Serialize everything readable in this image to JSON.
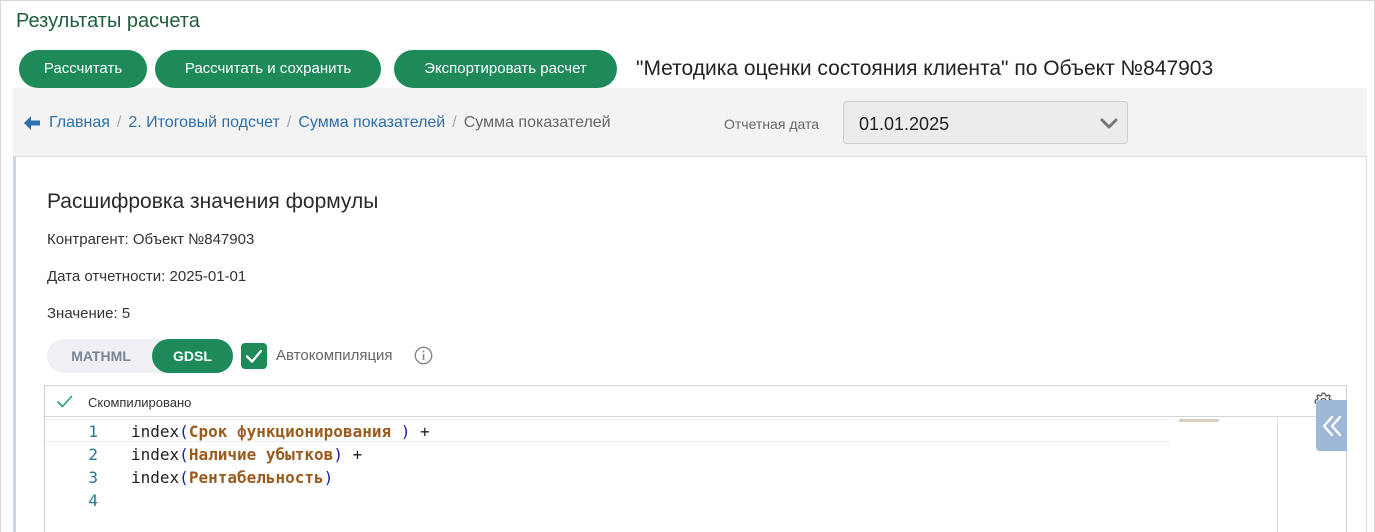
{
  "page": {
    "title": "Результаты расчета"
  },
  "actions": {
    "calculate": "Рассчитать",
    "calculate_save": "Рассчитать и сохранить",
    "export": "Экспортировать расчет"
  },
  "method_title": "\"Методика оценки состояния клиента\" по Объект №847903",
  "breadcrumb": {
    "items": [
      "Главная",
      "2. Итоговый подсчет",
      "Сумма показателей"
    ],
    "current": "Сумма показателей"
  },
  "report_date": {
    "label": "Отчетная дата",
    "value": "01.01.2025"
  },
  "formula": {
    "title": "Расшифровка значения формулы",
    "counterparty": "Контрагент: Объект №847903",
    "report_date": "Дата отчетности: 2025-01-01",
    "value": "Значение: 5"
  },
  "mode_toggle": {
    "options": [
      "MATHML",
      "GDSL"
    ],
    "selected": "GDSL"
  },
  "autocompile": {
    "label": "Автокомпиляция",
    "checked": true
  },
  "editor": {
    "status": "Скомпилировано",
    "lines": [
      {
        "num": "1",
        "func": "index",
        "arg": "Срок функционирования ",
        "suffix": " +"
      },
      {
        "num": "2",
        "func": "index",
        "arg": "Наличие убытков",
        "suffix": " +"
      },
      {
        "num": "3",
        "func": "index",
        "arg": "Рентабельность",
        "suffix": ""
      },
      {
        "num": "4",
        "func": "",
        "arg": "",
        "suffix": ""
      }
    ]
  },
  "colors": {
    "primary_green": "#1e8a5a",
    "link_blue": "#2e6fa8",
    "title_green": "#1f5e3c",
    "side_tab": "#9fb8d8"
  },
  "icons": [
    "back-arrow-icon",
    "chevron-down-icon",
    "checkmark-icon",
    "info-icon",
    "gear-icon",
    "double-chevron-left-icon"
  ]
}
